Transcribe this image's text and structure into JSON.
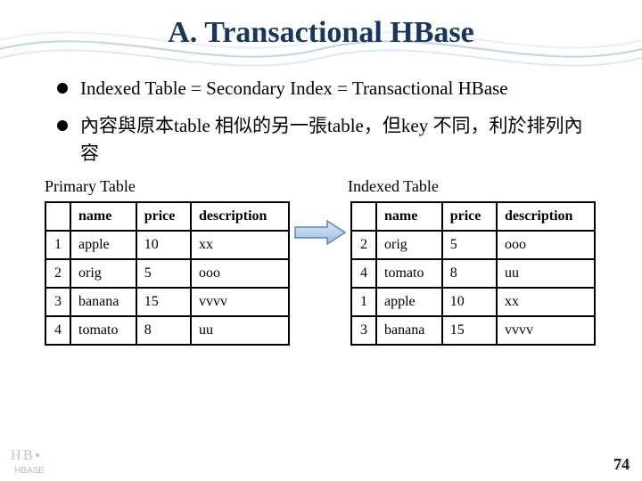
{
  "title": "A. Transactional HBase",
  "bullets": [
    "Indexed Table = Secondary Index = Transactional HBase",
    "內容與原本table 相似的另一張table，但key 不同，利於排列內容"
  ],
  "primary_label": "Primary Table",
  "indexed_label": "Indexed Table",
  "headers": {
    "col0": "",
    "col1": "name",
    "col2": "price",
    "col3": "description"
  },
  "primary_table": [
    {
      "n": "1",
      "name": "apple",
      "price": "10",
      "desc": "xx"
    },
    {
      "n": "2",
      "name": "orig",
      "price": "5",
      "desc": "ooo"
    },
    {
      "n": "3",
      "name": "banana",
      "price": "15",
      "desc": "vvvv"
    },
    {
      "n": "4",
      "name": "tomato",
      "price": "8",
      "desc": "uu"
    }
  ],
  "indexed_table": [
    {
      "n": "2",
      "name": "orig",
      "price": "5",
      "desc": "ooo"
    },
    {
      "n": "4",
      "name": "tomato",
      "price": "8",
      "desc": "uu"
    },
    {
      "n": "1",
      "name": "apple",
      "price": "10",
      "desc": "xx"
    },
    {
      "n": "3",
      "name": "banana",
      "price": "15",
      "desc": "vvvv"
    }
  ],
  "page_number": "74",
  "logo_text": "HBASE"
}
